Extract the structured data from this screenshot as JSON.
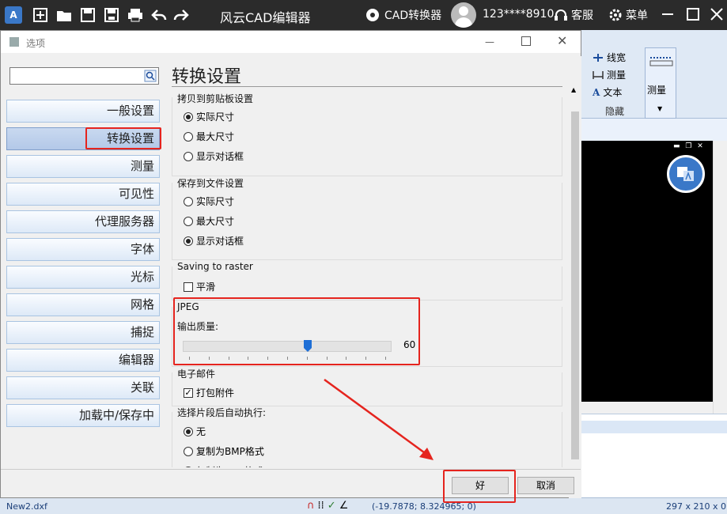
{
  "titlebar": {
    "title": "风云CAD编辑器",
    "converter_label": "CAD转换器",
    "user": "123****8910",
    "service_label": "客服",
    "menu_label": "菜单"
  },
  "ribbon": {
    "linewidth": "线宽",
    "measure_small": "测量",
    "text": "文本",
    "hide": "隐藏",
    "measure_big": "测量"
  },
  "dialog": {
    "title": "选项",
    "search_placeholder": "",
    "nav": [
      {
        "label": "一般设置"
      },
      {
        "label": "转换设置"
      },
      {
        "label": "测量"
      },
      {
        "label": "可见性"
      },
      {
        "label": "代理服务器"
      },
      {
        "label": "字体"
      },
      {
        "label": "光标"
      },
      {
        "label": "网格"
      },
      {
        "label": "捕捉"
      },
      {
        "label": "编辑器"
      },
      {
        "label": "关联"
      },
      {
        "label": "加载中/保存中"
      }
    ],
    "active_nav": "转换设置",
    "content_title": "转换设置",
    "clipboard_group": {
      "title": "拷贝到剪贴板设置",
      "options": [
        "实际尺寸",
        "最大尺寸",
        "显示对话框"
      ],
      "selected": "实际尺寸"
    },
    "file_group": {
      "title": "保存到文件设置",
      "options": [
        "实际尺寸",
        "最大尺寸",
        "显示对话框"
      ],
      "selected": "显示对话框"
    },
    "raster_group": {
      "title": "Saving to raster",
      "smooth_label": "平滑",
      "smooth_checked": false
    },
    "jpeg_group": {
      "title": "JPEG",
      "quality_label": "输出质量:",
      "quality_value": "60",
      "quality_fraction": 0.6
    },
    "email_group": {
      "title": "电子邮件",
      "pack_label": "打包附件",
      "pack_checked": true
    },
    "auto_group": {
      "title": "选择片段后自动执行:",
      "options": [
        "无",
        "复制为BMP格式",
        "复制为EMF格式"
      ],
      "selected": "无"
    },
    "ok_label": "好",
    "cancel_label": "取消"
  },
  "status": {
    "file": "New2.dxf",
    "coords": "(-19.7878; 8.324965; 0)",
    "size": "297 x 210 x 0"
  },
  "colors": {
    "highlight": "#e5241e",
    "titlebar": "#2b2b2b",
    "accent": "#3a78c8"
  }
}
